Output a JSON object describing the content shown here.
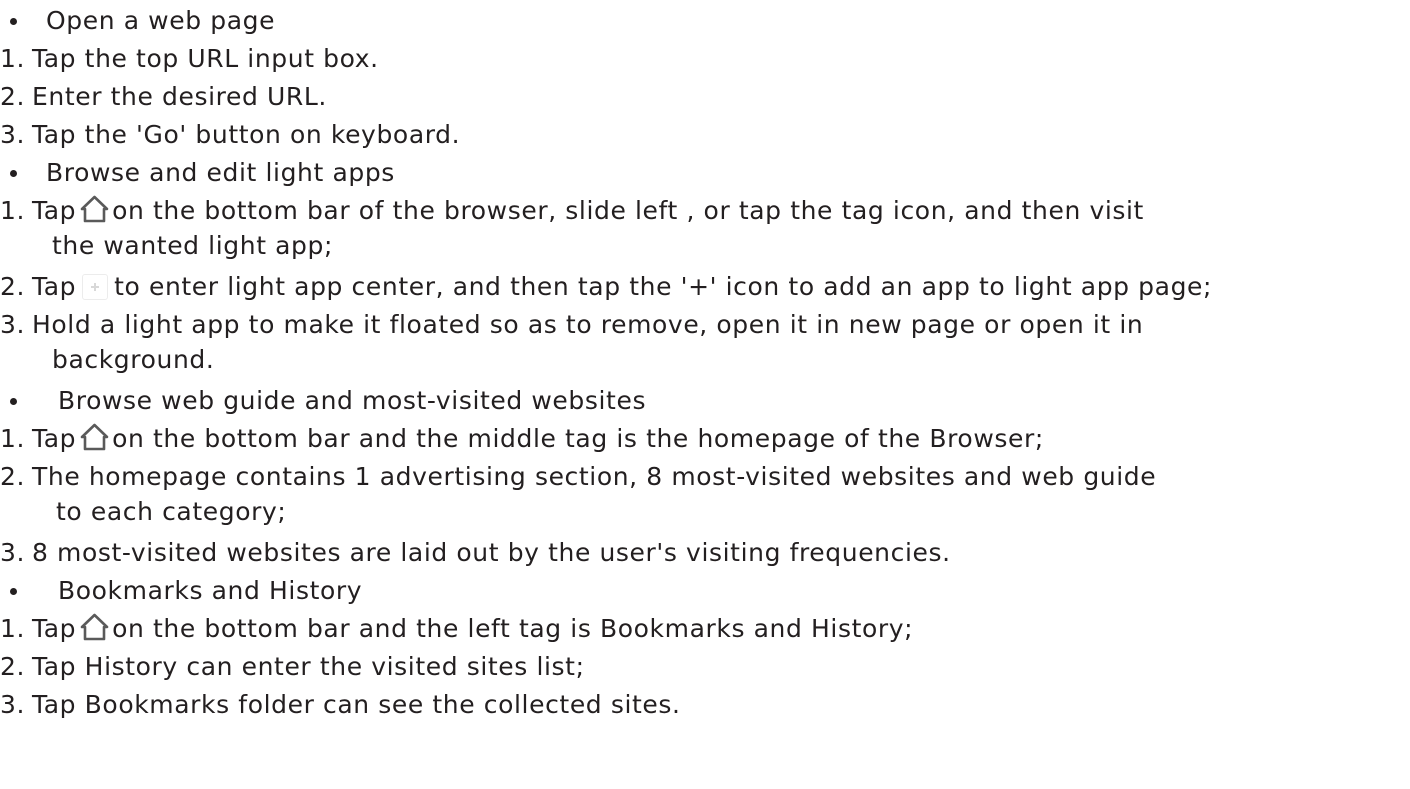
{
  "sections": [
    {
      "heading": "Open a web page",
      "steps": [
        "1.",
        "2.",
        "3."
      ]
    }
  ],
  "lines": {
    "s1_heading": "Open a web page",
    "s1_n1": "1.",
    "s1_t1": "Tap the top URL input box.",
    "s1_n2": "2.",
    "s1_t2": "Enter the desired URL.",
    "s1_n3": "3.",
    "s1_t3": "Tap the 'Go' button on keyboard.",
    "s2_heading": "Browse and edit light apps",
    "s2_n1": "1.",
    "s2_t1a": "Tap",
    "s2_t1b": "on the bottom bar of the browser, slide left , or tap the tag icon, and then visit",
    "s2_t1c": "the wanted light app;",
    "s2_n2": "2.",
    "s2_t2a": "Tap",
    "s2_t2b": "to enter light app center, and then tap the '+' icon to add an app to light app page;",
    "s2_n3": "3.",
    "s2_t3a": "Hold a light app to make it floated so as to remove, open it in new page or open it in",
    "s2_t3b": "background.",
    "s3_heading": "Browse web guide and most-visited websites",
    "s3_n1": "1.",
    "s3_t1a": "Tap",
    "s3_t1b": "on the bottom bar and the middle tag is the homepage of the Browser;",
    "s3_n2": "2.",
    "s3_t2a": "The homepage contains 1 advertising section, 8 most-visited websites and web guide",
    "s3_t2b": "to each category;",
    "s3_n3": "3.",
    "s3_t3": "8 most-visited websites are laid out by the user's visiting frequencies.",
    "s4_heading": "Bookmarks and History",
    "s4_n1": "1.",
    "s4_t1a": "Tap",
    "s4_t1b": "on the bottom bar and the left tag is Bookmarks and History;",
    "s4_n2": "2.",
    "s4_t2": "Tap History can enter the visited sites list;",
    "s4_n3": "3.",
    "s4_t3": "Tap Bookmarks folder can see the collected sites."
  },
  "icons": {
    "home": "home-icon",
    "add": "plus-icon"
  },
  "colors": {
    "text": "#231f20",
    "icon_stroke": "#5a5a5a",
    "background": "#ffffff"
  }
}
